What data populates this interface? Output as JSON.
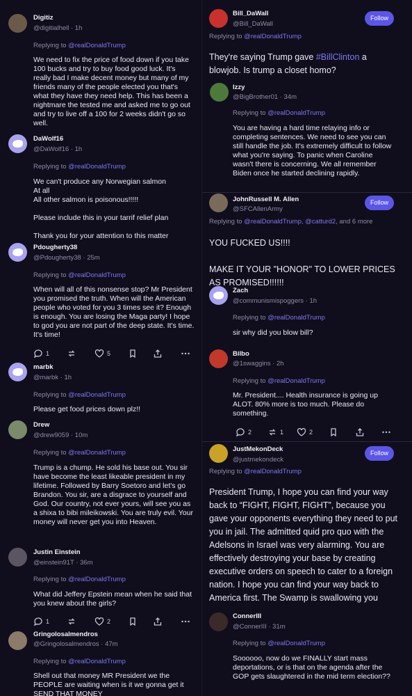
{
  "replying_prefix": "Replying to ",
  "follow_label": "Follow",
  "left": {
    "posts": [
      {
        "name": "Digitiz",
        "handle": "@digitialhell · 1h",
        "reply_to": "@realDonaldTrump",
        "text": "We need to fix the price of food down if you take 100 bucks and try to buy food good luck. It's really bad I make decent money but many of my friends many of the people elected you that's what they have they need help. This has been a nightmare the tested me and asked me to go out and try to live off a 100 for 2 weeks didn't go so well."
      },
      {
        "name": "DaWolf16",
        "handle": "@DaWolf16 · 1h",
        "reply_to": "@realDonaldTrump",
        "text": "We can't produce any Norwegian salmon\nAt all\nAll other salmon is poisonous!!!!!\n\nPlease include this in your tarrif relief plan\n\nThank you for your attention to this matter"
      },
      {
        "name": "Pdougherty38",
        "handle": "@Pdougherty38 · 25m",
        "reply_to": "@realDonaldTrump",
        "text": "When will all of this nonsense stop? Mr President you promised the truth. When will the American people who voted for you 3 times see it? Enough is enough. You are losing the Maga party! I hope to god you are not part of the deep state. It's time. It's time!",
        "actions": {
          "replies": "1",
          "reposts": "",
          "likes": "5"
        }
      },
      {
        "name": "marbk",
        "handle": "@marbk · 1h",
        "reply_to": "@realDonaldTrump",
        "text": "Please get food prices down plz!!"
      },
      {
        "name": "Drew",
        "handle": "@drew9059 · 10m",
        "reply_to": "@realDonaldTrump",
        "text": "Trump is a chump. He sold his base out. You sir have become the least likeable president in my lifetime. Followed by Barry Soetoro and let's go Brandon. You sir, are a disgrace to yourself and God. Our country, not ever yours, will see you as a shixa to bibi mileikowski. You are truly evil. Your money will never get you into Heaven."
      },
      {
        "name": "Justin Einstein",
        "handle": "@einstein91T · 36m",
        "reply_to": "@realDonaldTrump",
        "text": "What did Jeffery Epstein mean when he said that you knew about the girls?",
        "actions": {
          "replies": "1",
          "reposts": "",
          "likes": "2"
        }
      },
      {
        "name": "Gringolosalmendros",
        "handle": "@Gringolosalmendros · 47m",
        "reply_to": "@realDonaldTrump",
        "text": "Shell out that money MR President we the PEOPLE are waiting when is it we gonna get it SEND THAT MONEY"
      }
    ]
  },
  "right": {
    "posts": [
      {
        "name": "Bill_DaWall",
        "handle": "@Bill_DaWall",
        "reply_to": "@realDonaldTrump",
        "text_before": "They're saying Trump gave ",
        "hashtag": "#BillClinton",
        "text_after": " a blowjob. Is trump a closet homo?"
      },
      {
        "name": "Izzy",
        "handle": "@BigBrother01 · 34m",
        "reply_to": "@realDonaldTrump",
        "text": "You are having a hard time relaying info or completing sentences. We need to see you can still handle the job.  It's extremely difficult to follow what you're saying.  To panic when Caroline wasn't there is concerning.  We all remember Biden once he started declining rapidly."
      },
      {
        "name": "JohnRussell M. Allen",
        "handle": "@SFCAllenArmy",
        "reply_to": "@realDonaldTrump",
        "reply_extra": "@catturd2",
        "reply_suffix": ", and 6 more",
        "text": "YOU FUCKED US!!!!\n\nMAKE IT YOUR \"HONOR\" TO LOWER PRICES AS PROMISED!!!!!!"
      },
      {
        "name": "Zach",
        "handle": "@communismispoggers · 1h",
        "reply_to": "@realDonaldTrump",
        "text": "sir why did you blow bill?"
      },
      {
        "name": "Bilbo",
        "handle": "@1swaggins · 2h",
        "reply_to": "@realDonaldTrump",
        "text": "Mr. President.... Health insurance is going up ALOT. 80% more is too much. Please do something.",
        "actions": {
          "replies": "2",
          "reposts": "1",
          "likes": "2"
        }
      },
      {
        "name": "JustMekonDeck",
        "handle": "@justmekondeck",
        "reply_to": "@realDonaldTrump",
        "text": "President Trump, I hope you can find your way back to “FIGHT, FIGHT, FIGHT”, because you gave your opponents everything they need to put you in jail. The admitted quid pro quo with the Adelsons in Israel was very alarming.  You are effectively destroying your base by creating executive orders on speech to cater to a foreign nation.  I hope you can find your way back to America first.  The Swamp is swallowing you"
      },
      {
        "name": "ConnerIII",
        "handle": "@ConnerIII · 31m",
        "reply_to": "@realDonaldTrump",
        "text": "Soooooo, now do we FINALLY start mass deportations, or is that on the agenda after the GOP gets slaughtered in the mid term election??"
      }
    ]
  },
  "colors": {
    "accent": "#5b56e6",
    "mention": "#7d78f0",
    "background": "#100e1c"
  }
}
